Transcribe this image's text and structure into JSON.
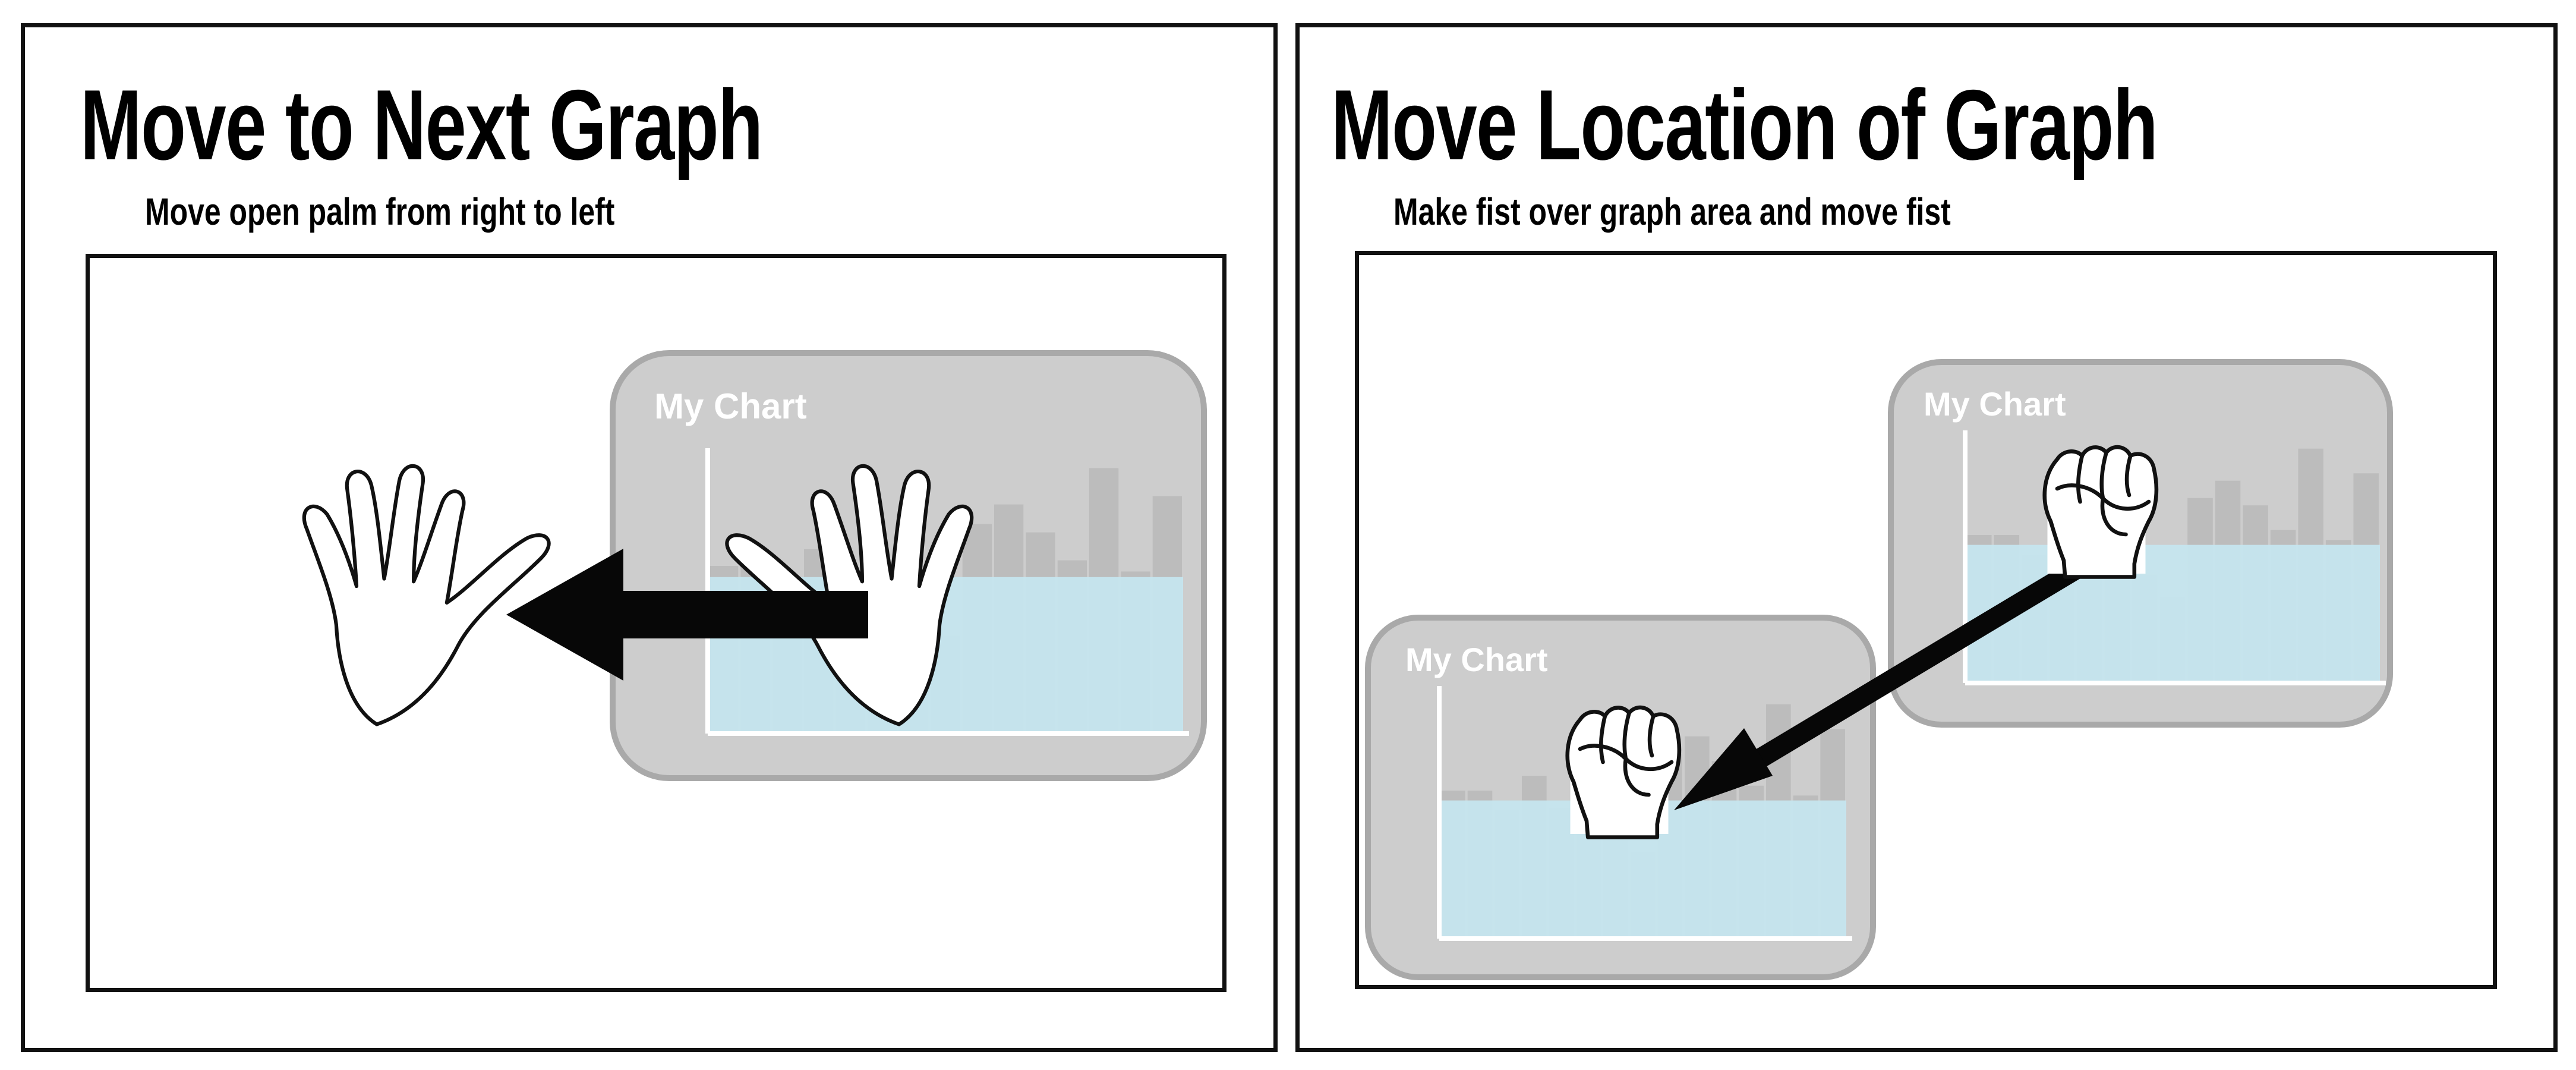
{
  "panels": [
    {
      "title": "Move to Next Graph",
      "subtitle": "Move open palm from right to left",
      "gesture_icons": [
        "open-hand-icon",
        "open-hand-icon",
        "left-arrow-icon"
      ]
    },
    {
      "title": "Move Location of Graph",
      "subtitle": "Make fist over graph area and move fist",
      "gesture_icons": [
        "fist-icon",
        "fist-icon",
        "diagonal-arrow-icon"
      ]
    }
  ],
  "chart_card": {
    "label": "My Chart"
  },
  "colors": {
    "card": "#cdcdcd",
    "card_border": "#a9a9a9",
    "fill_area": "#c6e6f0",
    "bars": "#bcbcbc",
    "outline": "#111111"
  },
  "chart_data": {
    "type": "bar",
    "title": "My Chart",
    "values": [
      0.6,
      0.6,
      0.52,
      0.66,
      0.53,
      0.6,
      0.44,
      0.35,
      0.75,
      0.82,
      0.72,
      0.62,
      0.95,
      0.58,
      0.85
    ]
  }
}
